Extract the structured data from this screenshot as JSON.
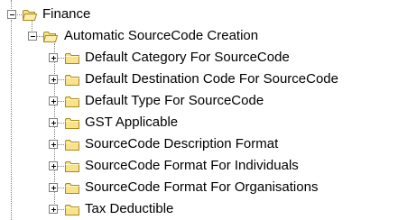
{
  "tree": {
    "root": {
      "label": "Finance",
      "icon": "folder-open-icon",
      "expanded": true
    },
    "child": {
      "label": "Automatic SourceCode Creation",
      "icon": "folder-open-icon",
      "expanded": true
    },
    "items": [
      {
        "label": "Default Category For SourceCode",
        "icon": "folder-icon",
        "expanded": false
      },
      {
        "label": "Default Destination Code For SourceCode",
        "icon": "folder-icon",
        "expanded": false
      },
      {
        "label": "Default Type For SourceCode",
        "icon": "folder-icon",
        "expanded": false
      },
      {
        "label": "GST Applicable",
        "icon": "folder-icon",
        "expanded": false
      },
      {
        "label": "SourceCode Description Format",
        "icon": "folder-icon",
        "expanded": false
      },
      {
        "label": "SourceCode Format For Individuals",
        "icon": "folder-icon",
        "expanded": false
      },
      {
        "label": "SourceCode Format For Organisations",
        "icon": "folder-icon",
        "expanded": false
      },
      {
        "label": "Tax Deductible",
        "icon": "folder-icon",
        "expanded": false
      }
    ]
  },
  "colors": {
    "folder_fill": "#f8e38a",
    "folder_stroke": "#a88a1e",
    "line": "#808080"
  }
}
